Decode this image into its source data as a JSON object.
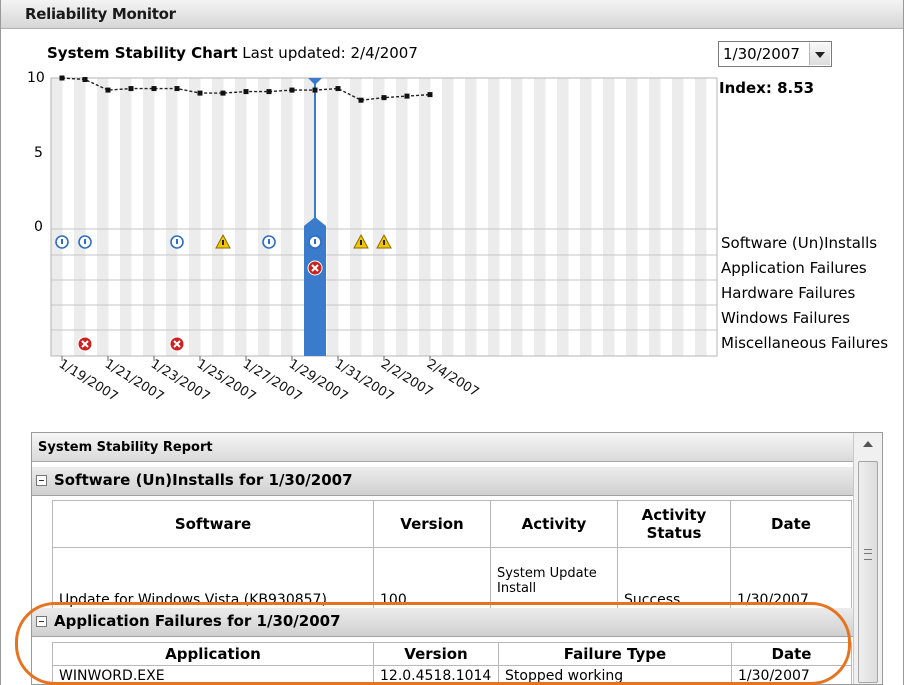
{
  "window": {
    "title": "Reliability Monitor"
  },
  "chart_header": {
    "title": "System Stability Chart",
    "last_updated": "Last updated: 2/4/2007"
  },
  "date_select": {
    "value": "1/30/2007"
  },
  "index_label": "Index: 8.53",
  "y_ticks": [
    "10",
    "5",
    "0"
  ],
  "row_labels": [
    "Software (Un)Installs",
    "Application Failures",
    "Hardware Failures",
    "Windows Failures",
    "Miscellaneous Failures"
  ],
  "x_tick_labels": [
    "1/19/2007",
    "1/21/2007",
    "1/23/2007",
    "1/25/2007",
    "1/27/2007",
    "1/29/2007",
    "1/31/2007",
    "2/2/2007",
    "2/4/2007"
  ],
  "chart_data": {
    "type": "line",
    "title": "System Stability Chart",
    "ylim": [
      0,
      10
    ],
    "x_start": "1/19/2007",
    "x_end": "2/4/2007",
    "selected_date": "1/30/2007",
    "series": [
      {
        "name": "Stability Index",
        "x": [
          "1/19/2007",
          "1/20/2007",
          "1/21/2007",
          "1/22/2007",
          "1/23/2007",
          "1/24/2007",
          "1/25/2007",
          "1/26/2007",
          "1/27/2007",
          "1/28/2007",
          "1/29/2007",
          "1/30/2007",
          "1/31/2007",
          "2/1/2007",
          "2/2/2007",
          "2/3/2007",
          "2/4/2007"
        ],
        "values": [
          10,
          9.9,
          9.2,
          9.3,
          9.3,
          9.3,
          9.0,
          9.0,
          9.1,
          9.1,
          9.2,
          9.2,
          9.3,
          8.53,
          8.7,
          8.8,
          8.9
        ]
      }
    ],
    "events": {
      "software_installs": {
        "info": [
          "1/19/2007",
          "1/20/2007",
          "1/24/2007",
          "1/28/2007",
          "1/30/2007"
        ],
        "warning": [
          "1/26/2007",
          "2/1/2007",
          "2/2/2007"
        ]
      },
      "application_failures": {
        "error": [
          "1/30/2007"
        ]
      },
      "miscellaneous_failures": {
        "error": [
          "1/20/2007",
          "1/24/2007"
        ]
      }
    }
  },
  "report": {
    "title": "System Stability Report",
    "software_section": {
      "title": "Software (Un)Installs for 1/30/2007",
      "headers": [
        "Software",
        "Version",
        "Activity",
        "Activity Status",
        "Date"
      ],
      "rows": [
        [
          "Update for Windows Vista (KB930857)",
          "100",
          "System Update Install",
          "Success",
          "1/30/2007"
        ]
      ]
    },
    "app_failures_section": {
      "title": "Application Failures for 1/30/2007",
      "headers": [
        "Application",
        "Version",
        "Failure Type",
        "Date"
      ],
      "rows": [
        [
          "WINWORD.EXE",
          "12.0.4518.1014",
          "Stopped working",
          "1/30/2007"
        ]
      ]
    }
  },
  "colors": {
    "selection": "#3a7ccb",
    "highlight_ring": "#e8731e",
    "error": "#cc2222",
    "warning": "#f2c500",
    "info": "#2e6fc4"
  }
}
